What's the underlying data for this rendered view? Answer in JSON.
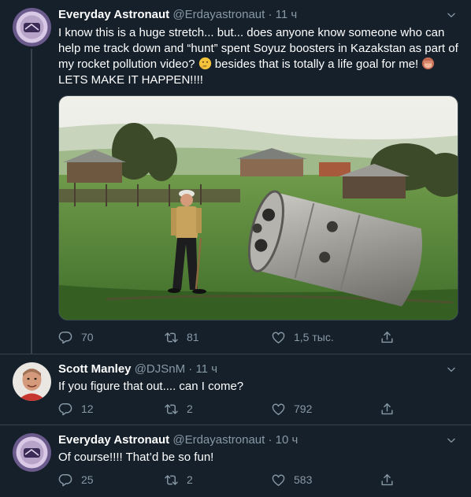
{
  "colors": {
    "background": "#15202b",
    "divider": "#38444d",
    "secondary_text": "#8899a6",
    "primary_text": "#ffffff"
  },
  "tweets": [
    {
      "name": "Everyday Astronaut",
      "handle": "@Erdayastronaut",
      "separator": "·",
      "time": "11 ч",
      "text_part1": "I know this is a huge stretch... but... does anyone know someone who can help me track down and “hunt” spent Soyuz boosters in Kazakstan as part of my rocket pollution video? ",
      "emoji1": "thinking-face",
      "text_part2": " besides that is totally a life goal for me! ",
      "emoji2": "see-no-evil-monkey",
      "text_part3": " LETS MAKE IT HAPPEN!!!!",
      "media": "photo-man-walking-past-spent-soyuz-booster-in-village",
      "replies": "70",
      "retweets": "81",
      "likes": "1,5 тыс.",
      "avatar": "astronaut-avatar"
    },
    {
      "name": "Scott Manley",
      "handle": "@DJSnM",
      "separator": "·",
      "time": "11 ч",
      "text": "If you figure that out.... can I come?",
      "replies": "12",
      "retweets": "2",
      "likes": "792",
      "avatar": "scott-manley-avatar"
    },
    {
      "name": "Everyday Astronaut",
      "handle": "@Erdayastronaut",
      "separator": "·",
      "time": "10 ч",
      "text": "Of course!!!! That’d be so fun!",
      "replies": "25",
      "retweets": "2",
      "likes": "583",
      "avatar": "astronaut-avatar"
    }
  ]
}
